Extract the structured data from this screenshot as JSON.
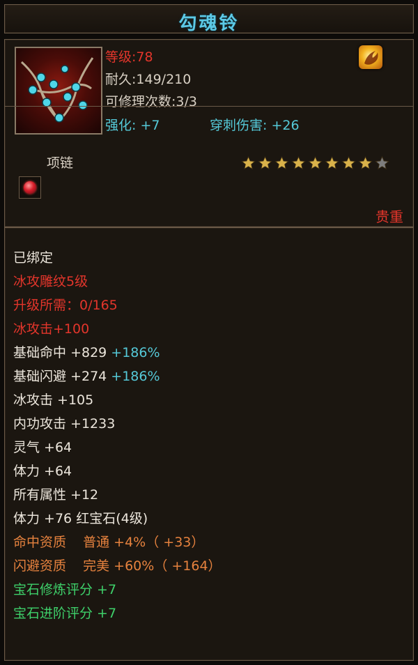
{
  "title": "勾魂铃",
  "item": {
    "level_label": "等级:",
    "level_value": "78",
    "durability": "耐久:149/210",
    "repair_count": "可修理次数:3/3",
    "enhance_label": "强化:",
    "enhance_value": "+7",
    "pierce_label": "穿刺伤害:",
    "pierce_value": "+26",
    "type": "项链",
    "stars_filled": 8,
    "stars_total": 9,
    "rarity": "贵重",
    "icon": "necklace-chain-icon",
    "class_icon": "flame-emblem-icon",
    "gem_icon": "red-gem-icon"
  },
  "details": {
    "bound": "已绑定",
    "engrave": "冰攻雕纹5级",
    "upgrade": "升级所需：0/165",
    "engrave_bonus": "冰攻击+100",
    "base_hit_label": "基础命中",
    "base_hit_value": "+829",
    "base_hit_pct": "+186%",
    "base_dodge_label": "基础闪避",
    "base_dodge_value": "+274",
    "base_dodge_pct": "+186%",
    "ice_attack": "冰攻击 +105",
    "inner_attack": "内功攻击 +1233",
    "spirit": "灵气 +64",
    "stamina": "体力 +64",
    "all_attr": "所有属性 +12",
    "gem_stat": "体力 +76",
    "gem_name": "红宝石(4级)",
    "hit_quality_label": "命中资质",
    "hit_quality_grade": "普通",
    "hit_quality_value": "+4%（ +33）",
    "dodge_quality_label": "闪避资质",
    "dodge_quality_grade": "完美",
    "dodge_quality_value": "+60%（ +164）",
    "gem_refine": "宝石修炼评分 +7",
    "gem_advance": "宝石进阶评分 +7"
  },
  "colors": {
    "title": "#5cc9e6",
    "red": "#e3352b",
    "cyan": "#55c9d8",
    "green": "#3ed06a",
    "orange": "#e6823e",
    "star_gold": "#d9b24a",
    "star_gray": "#7d7d7d"
  }
}
